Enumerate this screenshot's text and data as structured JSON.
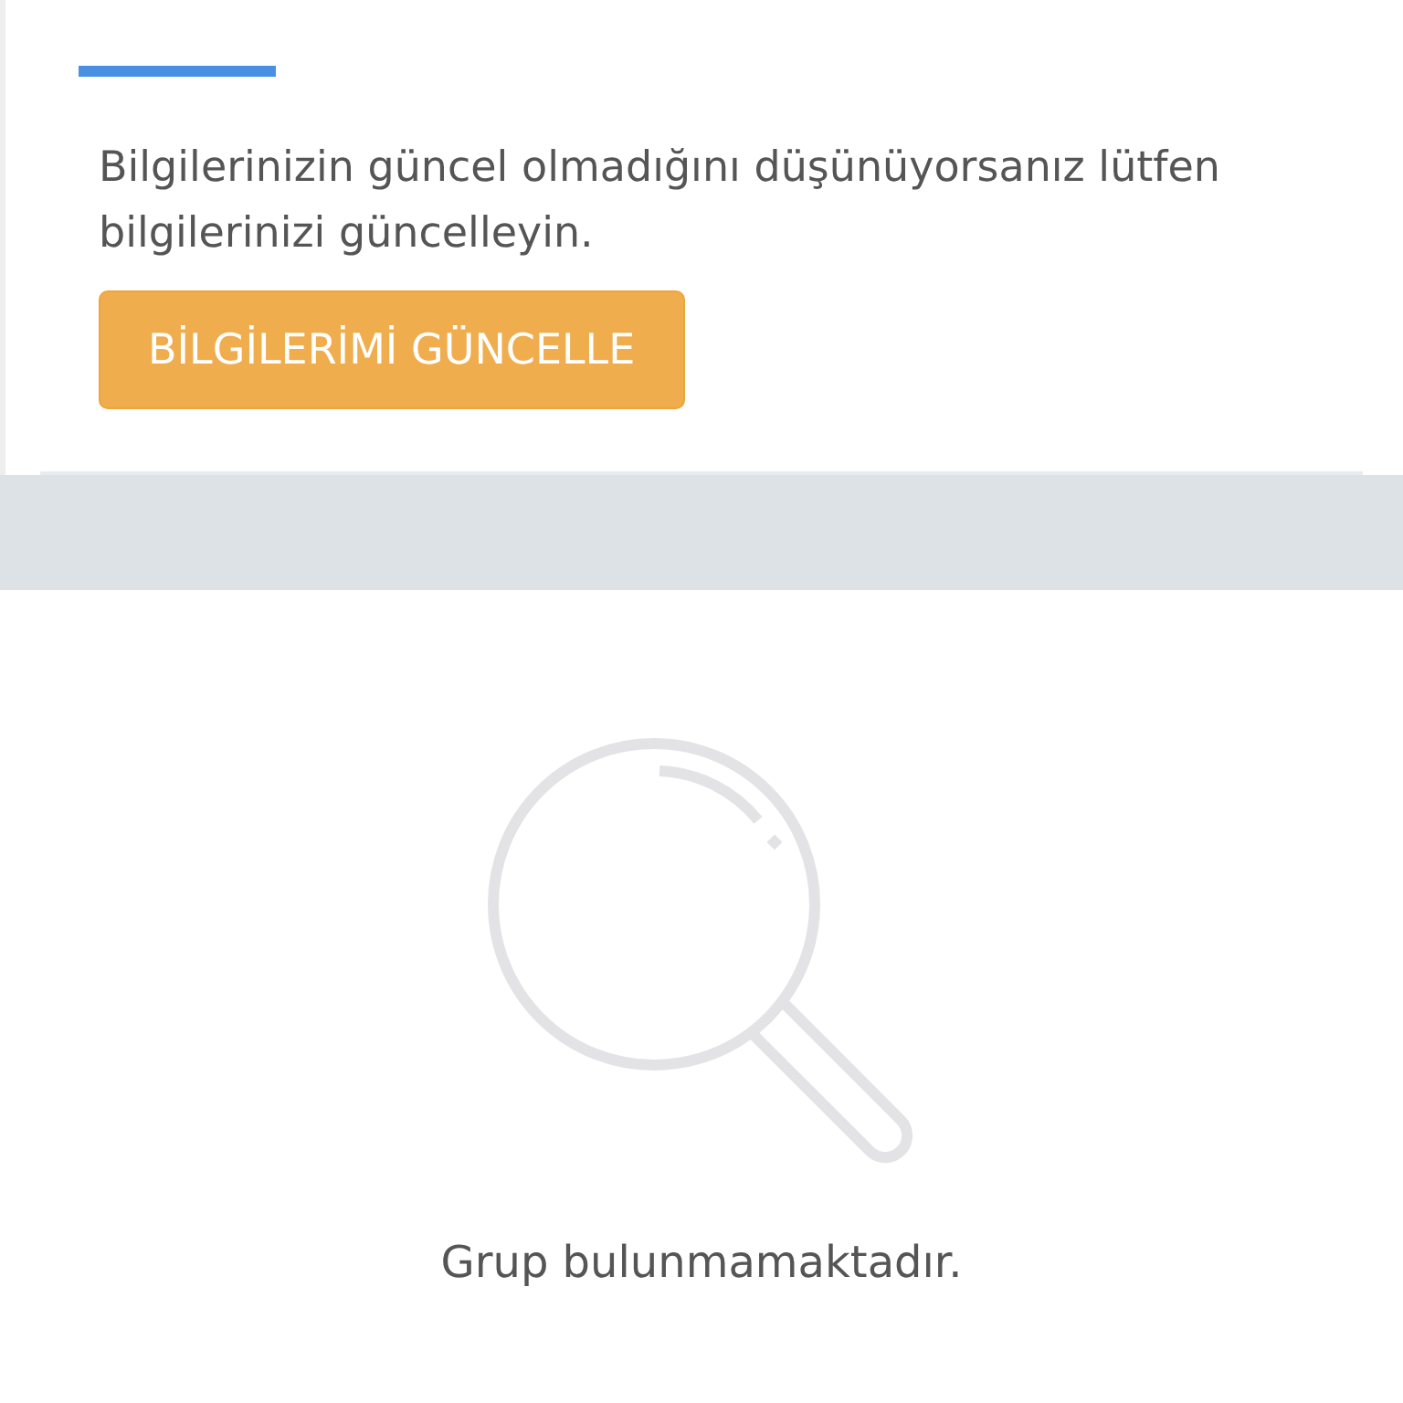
{
  "notice": {
    "text": "Bilgilerinizin güncel olmadığını düşünüyorsanız lütfen bilgilerinizi güncelleyin.",
    "button": "BİLGİLERİMİ GÜNCELLE"
  },
  "groups": {
    "empty_message": "Grup bulunmamaktadır."
  }
}
